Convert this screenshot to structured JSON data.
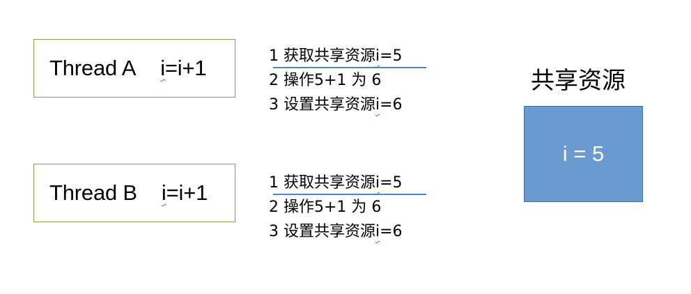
{
  "colors": {
    "thread_border": "#7fa24f",
    "shared_fill": "#6a9bd0",
    "shared_border": "#3f6e9f",
    "step_underline": "#4a86c8",
    "spellcheck_squiggle": "#c94a3c"
  },
  "threads": [
    {
      "name": "Thread A",
      "op_prefix": "i",
      "op_rest": "=i+1",
      "steps": [
        {
          "pre": "1 获取共享资源",
          "var": "i",
          "post": "=5"
        },
        {
          "pre": "2 操作5+1 为 6",
          "var": "",
          "post": ""
        },
        {
          "pre": "3 设置共享资源",
          "var": "i",
          "post": "=6"
        }
      ]
    },
    {
      "name": "Thread B",
      "op_prefix": "i",
      "op_rest": "=i+1",
      "steps": [
        {
          "pre": "1 获取共享资源",
          "var": "i",
          "post": "=5"
        },
        {
          "pre": "2 操作5+1 为 6",
          "var": "",
          "post": ""
        },
        {
          "pre": "3 设置共享资源",
          "var": "i",
          "post": "=6"
        }
      ]
    }
  ],
  "shared": {
    "title": "共享资源",
    "value_text": "i = 5"
  }
}
